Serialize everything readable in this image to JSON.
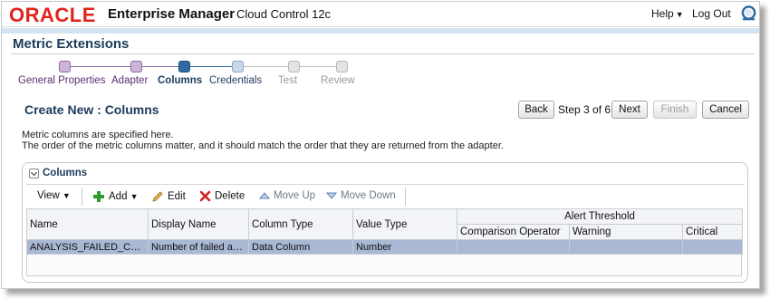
{
  "header": {
    "logo": "ORACLE",
    "app_title": "Enterprise Manager",
    "app_subtitle": "Cloud Control 12c",
    "help_label": "Help",
    "logout_label": "Log Out"
  },
  "page": {
    "title": "Metric Extensions"
  },
  "train": {
    "steps": [
      {
        "label": "General Properties",
        "state": "visited"
      },
      {
        "label": "Adapter",
        "state": "visited"
      },
      {
        "label": "Columns",
        "state": "current"
      },
      {
        "label": "Credentials",
        "state": "next"
      },
      {
        "label": "Test",
        "state": "disabled"
      },
      {
        "label": "Review",
        "state": "disabled"
      }
    ]
  },
  "wizard": {
    "title": "Create New : Columns",
    "back_label": "Back",
    "step_text": "Step 3 of 6",
    "next_label": "Next",
    "finish_label": "Finish",
    "cancel_label": "Cancel",
    "description_line1": "Metric columns are specified here.",
    "description_line2": "The order of the metric columns matter, and it should match the order that they are returned from the adapter."
  },
  "columns_panel": {
    "title": "Columns",
    "toolbar": {
      "view_label": "View",
      "add_label": "Add",
      "edit_label": "Edit",
      "delete_label": "Delete",
      "move_up_label": "Move Up",
      "move_down_label": "Move Down"
    },
    "table": {
      "headers": {
        "name": "Name",
        "display_name": "Display Name",
        "column_type": "Column Type",
        "value_type": "Value Type",
        "alert_threshold": "Alert Threshold",
        "comparison_operator": "Comparison Operator",
        "warning": "Warning",
        "critical": "Critical"
      },
      "rows": [
        {
          "name": "ANALYSIS_FAILED_COUNT",
          "display_name": "Number of failed an...",
          "column_type": "Data Column",
          "value_type": "Number",
          "comparison_operator": "",
          "warning": "",
          "critical": ""
        }
      ]
    }
  },
  "colors": {
    "oracle_red": "#e2231a",
    "title_blue": "#1c3b5c",
    "selected_row": "#a9b8d3",
    "train_visited": "#cdb5da",
    "train_current": "#2f6aa0"
  }
}
